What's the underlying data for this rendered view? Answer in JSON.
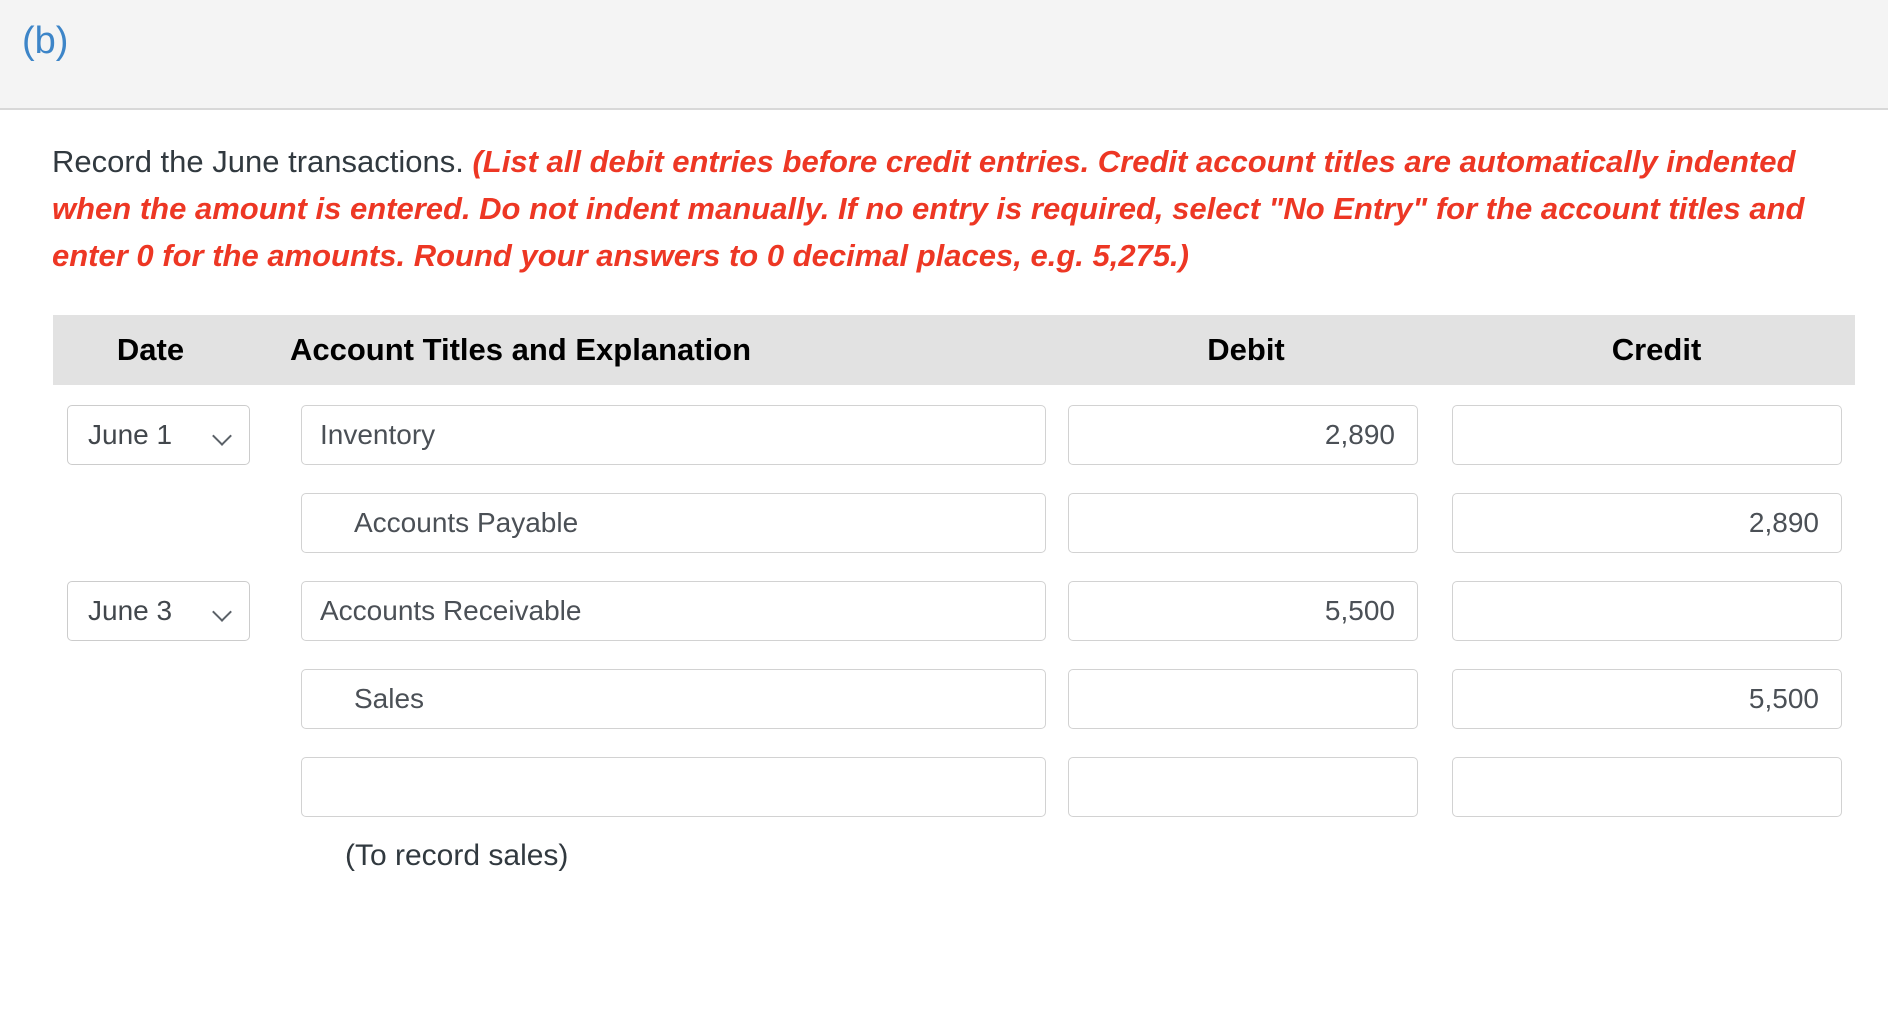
{
  "header": {
    "part_label": "(b)",
    "accent_color": "#3d85c8",
    "band_color": "#f4f4f4"
  },
  "instructions": {
    "lead": "Record the June transactions.",
    "note": "(List all debit entries before credit entries. Credit account titles are automatically indented when the amount is entered. Do not indent manually. If no entry is required, select \"No Entry\" for the account titles and enter 0 for the amounts. Round your answers to 0 decimal places, e.g. 5,275.)",
    "note_color": "#ed3724"
  },
  "table": {
    "header_bg": "#e2e2e2",
    "columns": {
      "date": "Date",
      "account": "Account Titles and Explanation",
      "debit": "Debit",
      "credit": "Credit"
    },
    "rows": [
      {
        "date": "June 1",
        "has_date": true,
        "account": "Inventory",
        "indented": false,
        "debit": "2,890",
        "credit": ""
      },
      {
        "date": "",
        "has_date": false,
        "account": "Accounts Payable",
        "indented": true,
        "debit": "",
        "credit": "2,890"
      },
      {
        "date": "June 3",
        "has_date": true,
        "account": "Accounts Receivable",
        "indented": false,
        "debit": "5,500",
        "credit": ""
      },
      {
        "date": "",
        "has_date": false,
        "account": "Sales",
        "indented": true,
        "debit": "",
        "credit": "5,500"
      },
      {
        "date": "",
        "has_date": false,
        "account": "",
        "indented": false,
        "debit": "",
        "credit": ""
      }
    ],
    "caption": "(To record sales)"
  }
}
